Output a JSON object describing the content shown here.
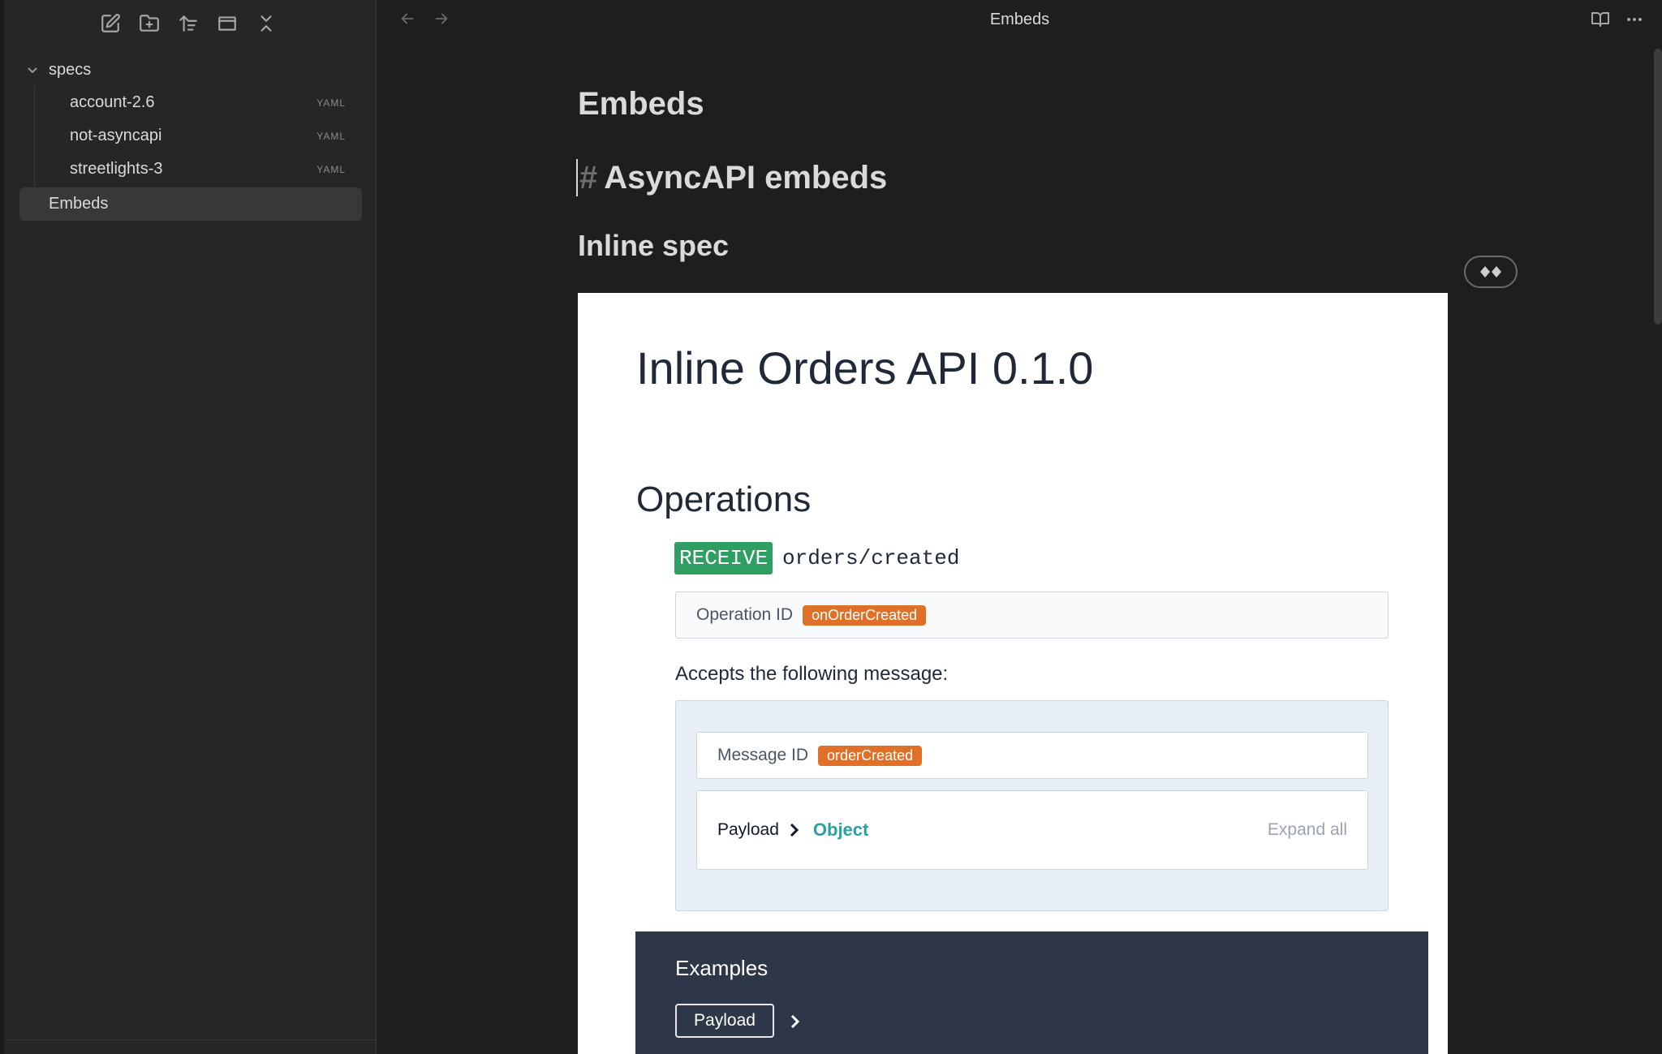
{
  "window": {
    "title": "Embeds"
  },
  "sidebar": {
    "toolbar": [
      {
        "name": "new-note-icon"
      },
      {
        "name": "new-folder-icon"
      },
      {
        "name": "sort-icon"
      },
      {
        "name": "panel-icon"
      },
      {
        "name": "collapse-all-icon"
      }
    ],
    "folder": {
      "label": "specs",
      "expanded": true
    },
    "files": [
      {
        "label": "account-2.6",
        "ext": "YAML"
      },
      {
        "label": "not-asyncapi",
        "ext": "YAML"
      },
      {
        "label": "streetlights-3",
        "ext": "YAML"
      }
    ],
    "active_file": {
      "label": "Embeds"
    }
  },
  "editor": {
    "h1": "Embeds",
    "h_hash": "#",
    "h_async": "AsyncAPI embeds",
    "h2": "Inline spec"
  },
  "asyncapi": {
    "title": "Inline Orders API 0.1.0",
    "operations_heading": "Operations",
    "operation": {
      "action": "RECEIVE",
      "channel": "orders/created",
      "id_label": "Operation ID",
      "id_value": "onOrderCreated",
      "accepts_text": "Accepts the following message:"
    },
    "message": {
      "id_label": "Message ID",
      "id_value": "orderCreated",
      "payload_label": "Payload",
      "payload_type": "Object",
      "expand_all": "Expand all"
    },
    "examples": {
      "title": "Examples",
      "payload_button": "Payload"
    }
  },
  "colors": {
    "receive": "#2f9e63",
    "badge_orange": "#e07028",
    "object_type": "#2aa1a1",
    "examples_bg": "#2d3748"
  }
}
